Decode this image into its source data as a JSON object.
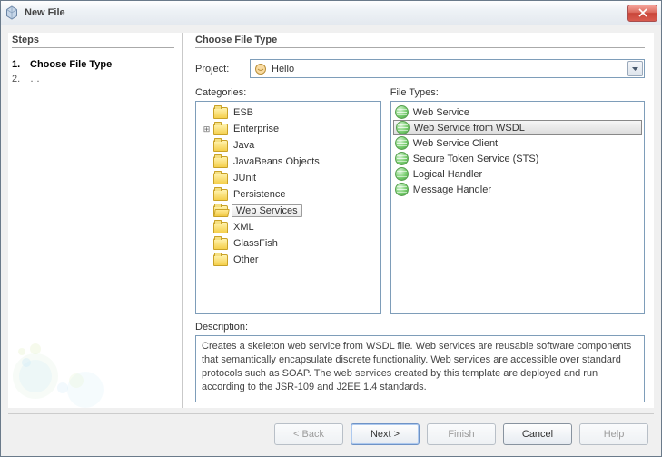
{
  "window": {
    "title": "New File"
  },
  "steps": {
    "heading": "Steps",
    "items": [
      {
        "num": "1.",
        "label": "Choose File Type",
        "current": true
      },
      {
        "num": "2.",
        "label": "…",
        "current": false
      }
    ]
  },
  "main": {
    "heading": "Choose File Type",
    "projectLabel": "Project:",
    "projectValue": "Hello",
    "categoriesLabel": "Categories:",
    "fileTypesLabel": "File Types:",
    "categories": [
      {
        "label": "ESB",
        "depth": 1
      },
      {
        "label": "Enterprise",
        "depth": 1,
        "expandable": true
      },
      {
        "label": "Java",
        "depth": 1
      },
      {
        "label": "JavaBeans Objects",
        "depth": 1
      },
      {
        "label": "JUnit",
        "depth": 1
      },
      {
        "label": "Persistence",
        "depth": 1
      },
      {
        "label": "Web Services",
        "depth": 1,
        "selected": true
      },
      {
        "label": "XML",
        "depth": 1
      },
      {
        "label": "GlassFish",
        "depth": 1
      },
      {
        "label": "Other",
        "depth": 1
      }
    ],
    "fileTypes": [
      {
        "label": "Web Service"
      },
      {
        "label": "Web Service from WSDL",
        "selected": true
      },
      {
        "label": "Web Service Client"
      },
      {
        "label": "Secure Token Service (STS)"
      },
      {
        "label": "Logical Handler"
      },
      {
        "label": "Message Handler"
      }
    ],
    "descriptionLabel": "Description:",
    "description": "Creates a skeleton web service from WSDL file. Web services are reusable software components that semantically encapsulate discrete functionality. Web services are accessible over standard protocols such as SOAP. The web services created by this template are deployed and run according to the JSR-109 and J2EE 1.4 standards."
  },
  "buttons": {
    "back": "< Back",
    "next": "Next >",
    "finish": "Finish",
    "cancel": "Cancel",
    "help": "Help"
  }
}
